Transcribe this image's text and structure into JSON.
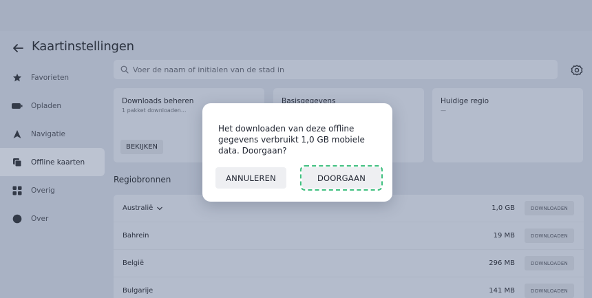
{
  "header": {
    "title": "Kaartinstellingen"
  },
  "sidebar": {
    "items": [
      {
        "label": "Favorieten",
        "icon": "star-icon"
      },
      {
        "label": "Opladen",
        "icon": "battery-icon"
      },
      {
        "label": "Navigatie",
        "icon": "navigation-arrow-icon"
      },
      {
        "label": "Offline kaarten",
        "icon": "map-stack-icon",
        "active": true
      },
      {
        "label": "Overig",
        "icon": "grid-icon"
      },
      {
        "label": "Over",
        "icon": "info-circle-icon"
      }
    ]
  },
  "search": {
    "placeholder": "Voer de naam of initialen van de stad in"
  },
  "cards": [
    {
      "title": "Downloads beheren",
      "subtitle": "1 pakket downloaden...",
      "button": "BEKIJKEN"
    },
    {
      "title": "Basisgegevens",
      "subtitle": "",
      "button": ""
    },
    {
      "title": "Huidige regio",
      "subtitle": "—",
      "button": ""
    }
  ],
  "regions": {
    "title": "Regiobronnen",
    "rows": [
      {
        "name": "Australië",
        "size": "1,0 GB",
        "action": "DOWNLOADEN",
        "expandable": true
      },
      {
        "name": "Bahrein",
        "size": "19 MB",
        "action": "DOWNLOADEN"
      },
      {
        "name": "België",
        "size": "296 MB",
        "action": "DOWNLOADEN"
      },
      {
        "name": "Bulgarije",
        "size": "141 MB",
        "action": "DOWNLOADEN"
      }
    ]
  },
  "dialog": {
    "message": "Het downloaden van deze offline gegevens verbruikt 1,0 GB mobiele data. Doorgaan?",
    "cancel_label": "ANNULEREN",
    "confirm_label": "DOORGAAN"
  },
  "colors": {
    "overlay_bg": "#a9b2c4",
    "dialog_bg": "#ffffff",
    "focus_outline": "#3fbf7f"
  }
}
